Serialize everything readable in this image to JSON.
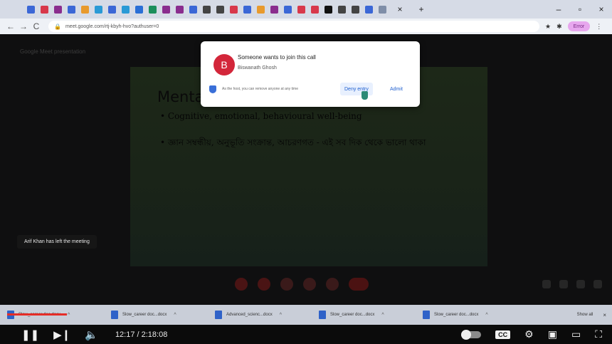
{
  "browser": {
    "tab_icon_colors": [
      "#3b67d6",
      "#d8384b",
      "#8a2d8e",
      "#3b67d6",
      "#e89a2d",
      "#2a9ad6",
      "#3b67d6",
      "#2a9ad6",
      "#2a6fd6",
      "#1d8f5c",
      "#8a2d8e",
      "#8a2d8e",
      "#3b67d6",
      "#444444",
      "#444444",
      "#d8384b",
      "#3b67d6",
      "#e89a2d",
      "#8a2d8e",
      "#3b67d6",
      "#d8384b",
      "#d8384b",
      "#111111",
      "#444444",
      "#444444",
      "#3b67d6",
      "#7f8ea8"
    ],
    "active_tab_close": "×",
    "new_tab": "+",
    "window_minimize": "–",
    "window_maximize": "▫",
    "window_close": "×",
    "back_icon": "←",
    "forward_icon": "→",
    "reload_icon": "C",
    "url": "meet.google.com/rtj-kbyh-hvo?authuser=0",
    "profile_label": "Error"
  },
  "meet": {
    "meeting_title": "Google Meet presentation",
    "popup": {
      "avatar_letter": "B",
      "title": "Someone wants to join this call",
      "name": "Biswanath Ghosh",
      "note": "As the host, you can remove anyone at any time",
      "deny_label": "Deny entry",
      "admit_label": "Admit"
    },
    "slide": {
      "title": "Menta",
      "bullet1": "• Cognitive, emotional, behavioural well-being",
      "bullet2": "• জ্ঞান সম্বন্ধীয়, অনুভূতি সংক্রান্ত, আচরণগত - এই সব দিক থেকে ভালো থাকা"
    },
    "toast": "Arif Khan has left the meeting"
  },
  "downloads": {
    "items": [
      {
        "name": "Slow_career doc.docx"
      },
      {
        "name": "Slow_career doc...docx"
      },
      {
        "name": "Advanced_scienc...docx"
      },
      {
        "name": "Slow_career doc...docx"
      },
      {
        "name": "Slow_career doc...docx"
      }
    ],
    "chevron": "^",
    "show_all": "Show all",
    "close": "×"
  },
  "player": {
    "pause_icon": "❚❚",
    "next_icon": "▶❙",
    "volume_icon": "🔈",
    "time": "12:17 / 2:18:08",
    "autoplay_progress": 0.25,
    "cc_label": "CC",
    "settings_icon": "⚙",
    "miniplayer_icon": "▣",
    "theater_icon": "▭",
    "fullscreen_icon": "⛶"
  }
}
